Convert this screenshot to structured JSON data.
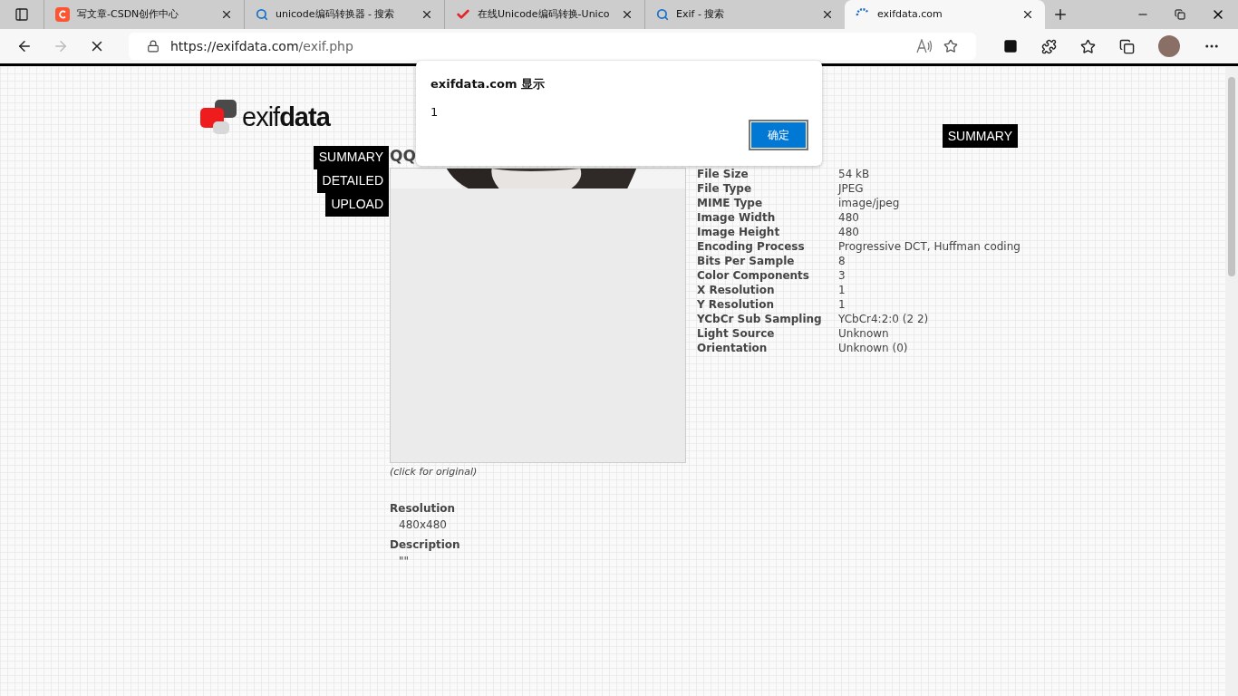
{
  "tabs": [
    {
      "title": "写文章-CSDN创作中心",
      "kind": "csdn",
      "selected": false
    },
    {
      "title": "unicode编码转换器 - 搜索",
      "kind": "search",
      "selected": false
    },
    {
      "title": "在线Unicode编码转换-Unico",
      "kind": "check",
      "selected": false
    },
    {
      "title": "Exif - 搜索",
      "kind": "search",
      "selected": false
    },
    {
      "title": "exifdata.com",
      "kind": "loading",
      "selected": true
    }
  ],
  "address_bar": {
    "host": "https://exifdata.com",
    "path": "/exif.php"
  },
  "site": {
    "logo_light": "exif",
    "logo_bold": "data",
    "nav": [
      {
        "label": "SUMMARY"
      },
      {
        "label": "DETAILED"
      },
      {
        "label": "UPLOAD"
      }
    ],
    "top_button": "SUMMARY",
    "image_title": "QQ",
    "image_caption": "(click for original)",
    "info": [
      {
        "label": "Resolution",
        "value": "480x480"
      },
      {
        "label": "Description",
        "value": "\"\""
      }
    ],
    "exif": [
      {
        "label": "File Size",
        "value": "54 kB"
      },
      {
        "label": "File Type",
        "value": "JPEG"
      },
      {
        "label": "MIME Type",
        "value": "image/jpeg"
      },
      {
        "label": "Image Width",
        "value": "480"
      },
      {
        "label": "Image Height",
        "value": "480"
      },
      {
        "label": "Encoding Process",
        "value": "Progressive DCT, Huffman coding"
      },
      {
        "label": "Bits Per Sample",
        "value": "8"
      },
      {
        "label": "Color Components",
        "value": "3"
      },
      {
        "label": "X Resolution",
        "value": "1"
      },
      {
        "label": "Y Resolution",
        "value": "1"
      },
      {
        "label": "YCbCr Sub Sampling",
        "value": "YCbCr4:2:0 (2 2)"
      },
      {
        "label": "Light Source",
        "value": "Unknown"
      },
      {
        "label": "Orientation",
        "value": "Unknown (0)"
      }
    ]
  },
  "dialog": {
    "title": "exifdata.com 显示",
    "message": "1",
    "button": "确定"
  }
}
